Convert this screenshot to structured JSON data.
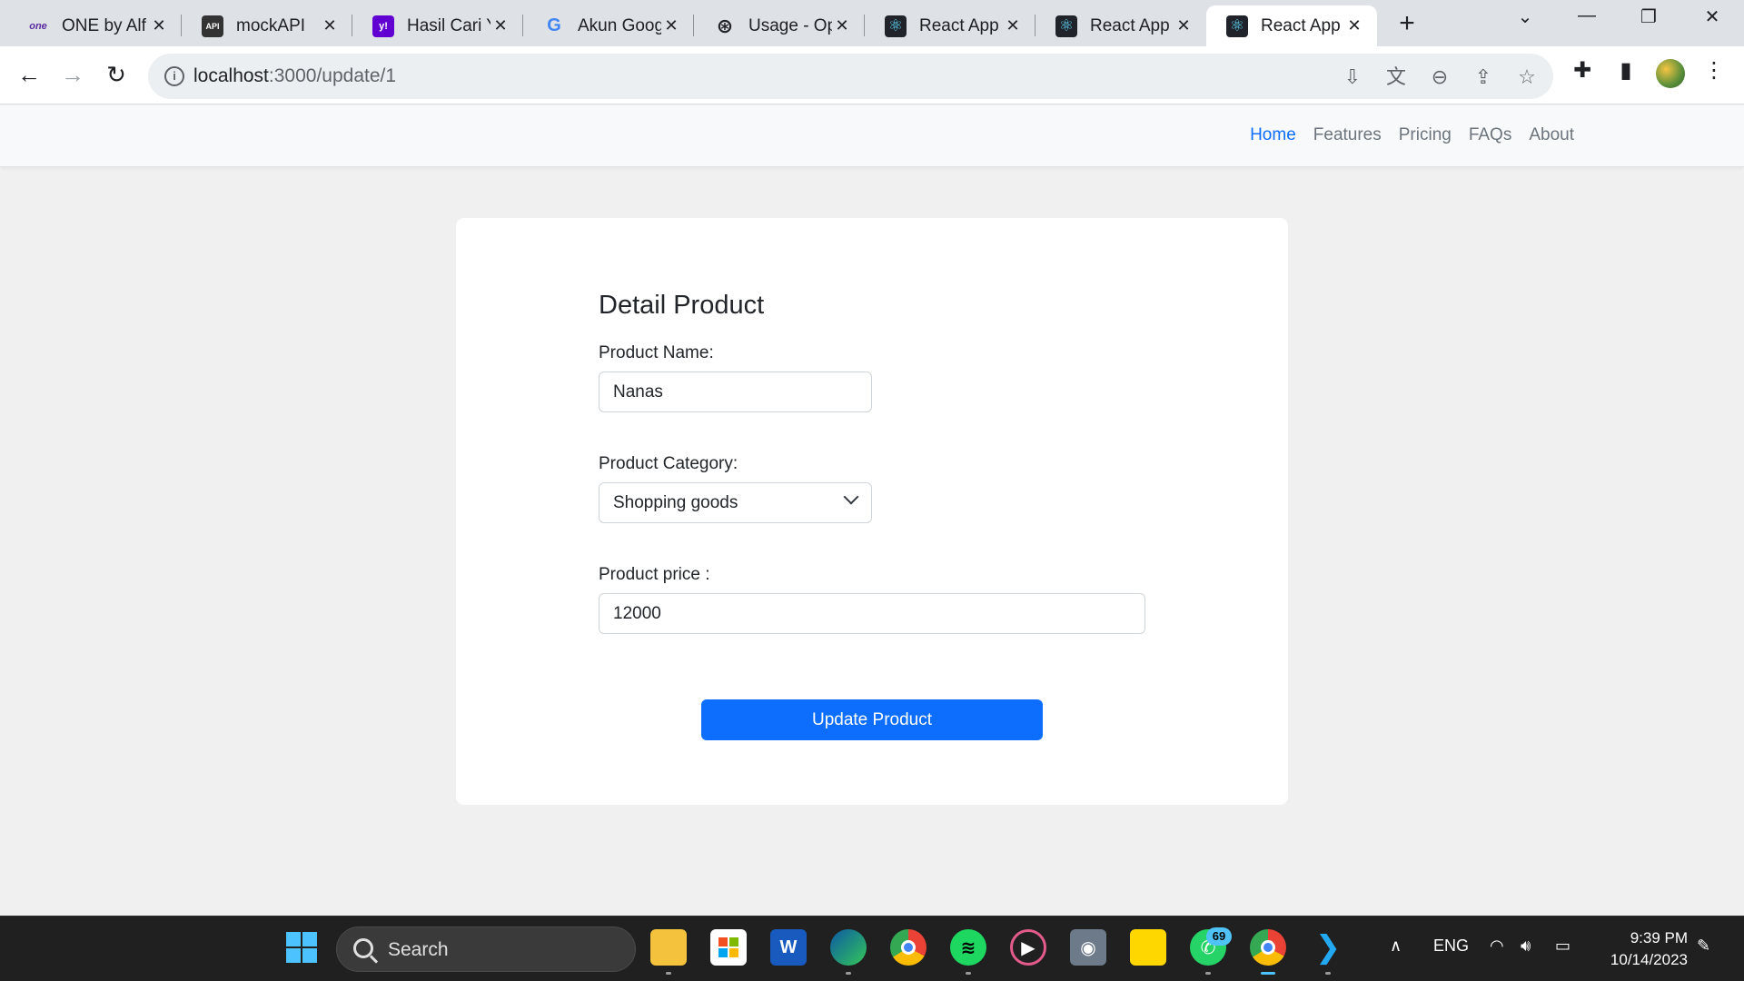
{
  "browser": {
    "tabs": [
      {
        "title": "ONE by Alf",
        "favicon": "one-logo",
        "favicon_text": "one",
        "favicon_color": "#ffffff",
        "active": false
      },
      {
        "title": "mockAPI",
        "favicon": "mockapi-logo",
        "favicon_text": "API",
        "favicon_color": "#333333",
        "active": false
      },
      {
        "title": "Hasil Cari Y",
        "favicon": "yahoo-logo",
        "favicon_text": "y!",
        "favicon_color": "#6001d2",
        "active": false
      },
      {
        "title": "Akun Goog",
        "favicon": "google-logo",
        "favicon_text": "G",
        "favicon_color": "#ffffff",
        "active": false
      },
      {
        "title": "Usage - Op",
        "favicon": "openai-logo",
        "favicon_text": "⊛",
        "favicon_color": "#ffffff",
        "active": false
      },
      {
        "title": "React App",
        "favicon": "react-logo",
        "favicon_text": "⚛",
        "favicon_color": "#20232a",
        "active": false
      },
      {
        "title": "React App",
        "favicon": "react-logo",
        "favicon_text": "⚛",
        "favicon_color": "#20232a",
        "active": false
      },
      {
        "title": "React App",
        "favicon": "react-logo",
        "favicon_text": "⚛",
        "favicon_color": "#20232a",
        "active": true
      }
    ],
    "url_host": "localhost",
    "url_path": ":3000/update/1"
  },
  "nav": {
    "links": [
      "Home",
      "Features",
      "Pricing",
      "FAQs",
      "About"
    ],
    "active_link": "Home"
  },
  "form": {
    "title": "Detail Product",
    "name_label": "Product Name:",
    "name_value": "Nanas",
    "category_label": "Product Category:",
    "category_value": "Shopping goods",
    "price_label": "Product price :",
    "price_value": "12000",
    "submit_label": "Update Product"
  },
  "taskbar": {
    "search_placeholder": "Search",
    "whatsapp_badge": "69",
    "language": "ENG",
    "time": "9:39 PM",
    "date": "10/14/2023"
  },
  "colors": {
    "accent": "#0d6efd",
    "nav_bg": "#f8f9fa",
    "page_bg": "#f0f0f0"
  }
}
